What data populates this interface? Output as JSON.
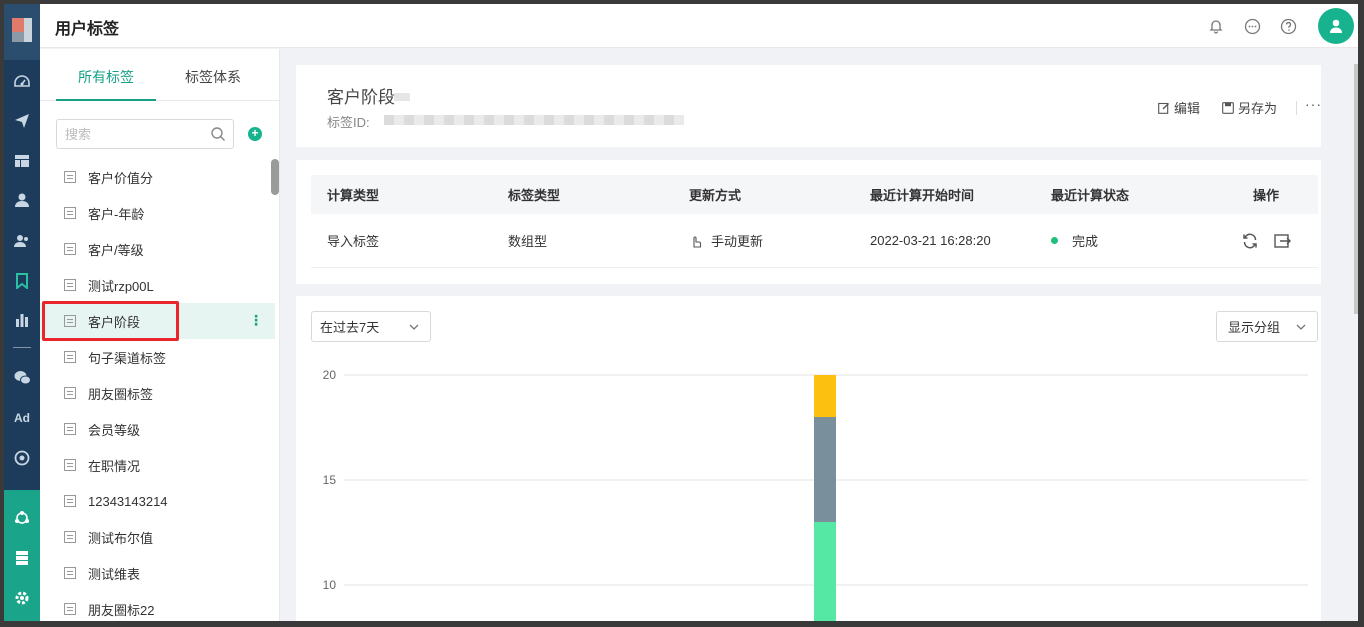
{
  "app": {
    "title": "用户标签"
  },
  "tag_panel": {
    "tabs": [
      {
        "label": "所有标签",
        "active": true
      },
      {
        "label": "标签体系",
        "active": false
      }
    ],
    "search_placeholder": "搜索",
    "items": [
      {
        "label": "客户价值分"
      },
      {
        "label": "客户-年龄"
      },
      {
        "label": "客户/等级"
      },
      {
        "label": "测试rzp00L"
      },
      {
        "label": "客户阶段",
        "selected": true
      },
      {
        "label": "句子渠道标签"
      },
      {
        "label": "朋友圈标签"
      },
      {
        "label": "会员等级"
      },
      {
        "label": "在职情况"
      },
      {
        "label": "12343143214"
      },
      {
        "label": "测试布尔值"
      },
      {
        "label": "测试维表"
      },
      {
        "label": "朋友圈标22"
      }
    ]
  },
  "detail": {
    "title": "客户阶段",
    "id_label": "标签ID:",
    "actions": {
      "edit": "编辑",
      "save_as": "另存为",
      "more": "···"
    }
  },
  "info_table": {
    "columns": [
      "计算类型",
      "标签类型",
      "更新方式",
      "最近计算开始时间",
      "最近计算状态",
      "操作"
    ],
    "row": {
      "calc_type": "导入标签",
      "tag_type": "数组型",
      "update_mode": "手动更新",
      "last_calc_time": "2022-03-21 16:28:20",
      "status": "完成",
      "status_color": "#1fc07d"
    }
  },
  "chart_controls": {
    "period": "在过去7天",
    "group_toggle": "显示分组"
  },
  "chart_data": {
    "type": "bar",
    "stacked": true,
    "y_ticks": [
      20,
      15,
      10
    ],
    "ylim_visible": [
      10,
      20
    ],
    "categories": [
      ""
    ],
    "series": [
      {
        "values": [
          13
        ],
        "color": "#54e8a4"
      },
      {
        "values": [
          5
        ],
        "color": "#798f9c"
      },
      {
        "values": [
          2
        ],
        "color": "#fcc010"
      }
    ],
    "grid": true
  },
  "colors": {
    "accent": "#17a085",
    "rail": "#1d3c5c",
    "highlight": "#e8262b"
  }
}
